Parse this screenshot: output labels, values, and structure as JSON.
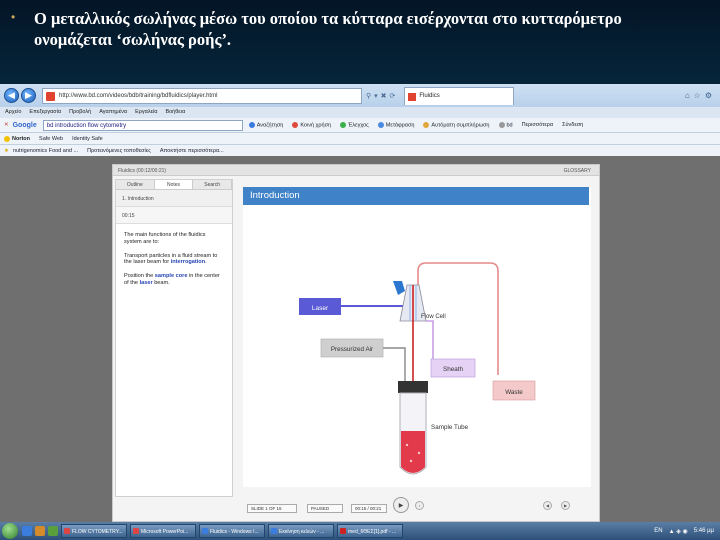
{
  "slide": {
    "bullet": "•",
    "text": "Ο μεταλλικός σωλήνας μέσω του οποίου τα κύτταρα εισέρχονται στο κυτταρόμετρο ονομάζεται ‘σωλήνας ροής’."
  },
  "browser": {
    "address": "http://www.bd.com/videos/bdb/training/bdfluidics/player.html",
    "tab_label": "Fluidics",
    "menu": [
      "Αρχείο",
      "Επεξεργασία",
      "Προβολή",
      "Αγαπημένα",
      "Εργαλεία",
      "Βοήθεια"
    ],
    "google": {
      "logo": "Google",
      "search_value": "bd introduction flow cytometry",
      "items": [
        "Αναζήτηση",
        "Κοινή χρήση",
        "Έλεγχος",
        "Μετάφραση",
        "Αυτόματη συμπλήρωση",
        "bd",
        "Περισσότερα",
        "Σύνδεση"
      ]
    },
    "norton": {
      "label": "Norton",
      "items": [
        "Safe Web",
        "Identity Safe"
      ]
    },
    "bookmarks": [
      "nutrigenomics Food and ...",
      "Προτεινόμενες τοποθεσίες",
      "Αποκτήστε περισσότερα..."
    ]
  },
  "player": {
    "header_title": "Fluidics   (00:12/00:21)",
    "glossary": "GLOSSARY",
    "tabs": [
      "Outline",
      "Notes",
      "Search"
    ],
    "section": "1. Introduction",
    "time": "00:15",
    "notes": {
      "p1": "The main functions of the fluidics system are to:",
      "p2_pre": "Transport particles in a fluid stream to the laser beam for ",
      "p2_hl": "interrogation",
      "p2_post": ".",
      "p3_a": "Position the ",
      "p3_hl1": "sample core",
      "p3_b": " in the center of the ",
      "p3_hl2": "laser",
      "p3_c": " beam."
    },
    "stage_title": "Introduction",
    "diagram": {
      "laser": "Laser",
      "flow_cell": "Flow Cell",
      "pressurized_air": "Pressurized Air",
      "sheath": "Sheath",
      "waste": "Waste",
      "sample_tube": "Sample Tube"
    },
    "controls": {
      "slide_counter": "SLIDE 1 OF 15",
      "status": "PAUSED",
      "time": "00:15 / 00:21"
    },
    "colors": {
      "laser": "#5a5ad6",
      "sheath": "#c8a0e8",
      "waste": "#f4c9c9",
      "intro_bar": "#3f82c8"
    }
  },
  "taskbar": {
    "tasks": [
      "FLOW CYTOMETRY...",
      "Microsoft PowerPoi...",
      "Fluidics - Windows I...",
      "Εκκίνηση κελιών - ...",
      "med_6ΘΕΣ[1].pdf - ..."
    ],
    "lang": "EN",
    "clock": "5:46 μμ"
  }
}
